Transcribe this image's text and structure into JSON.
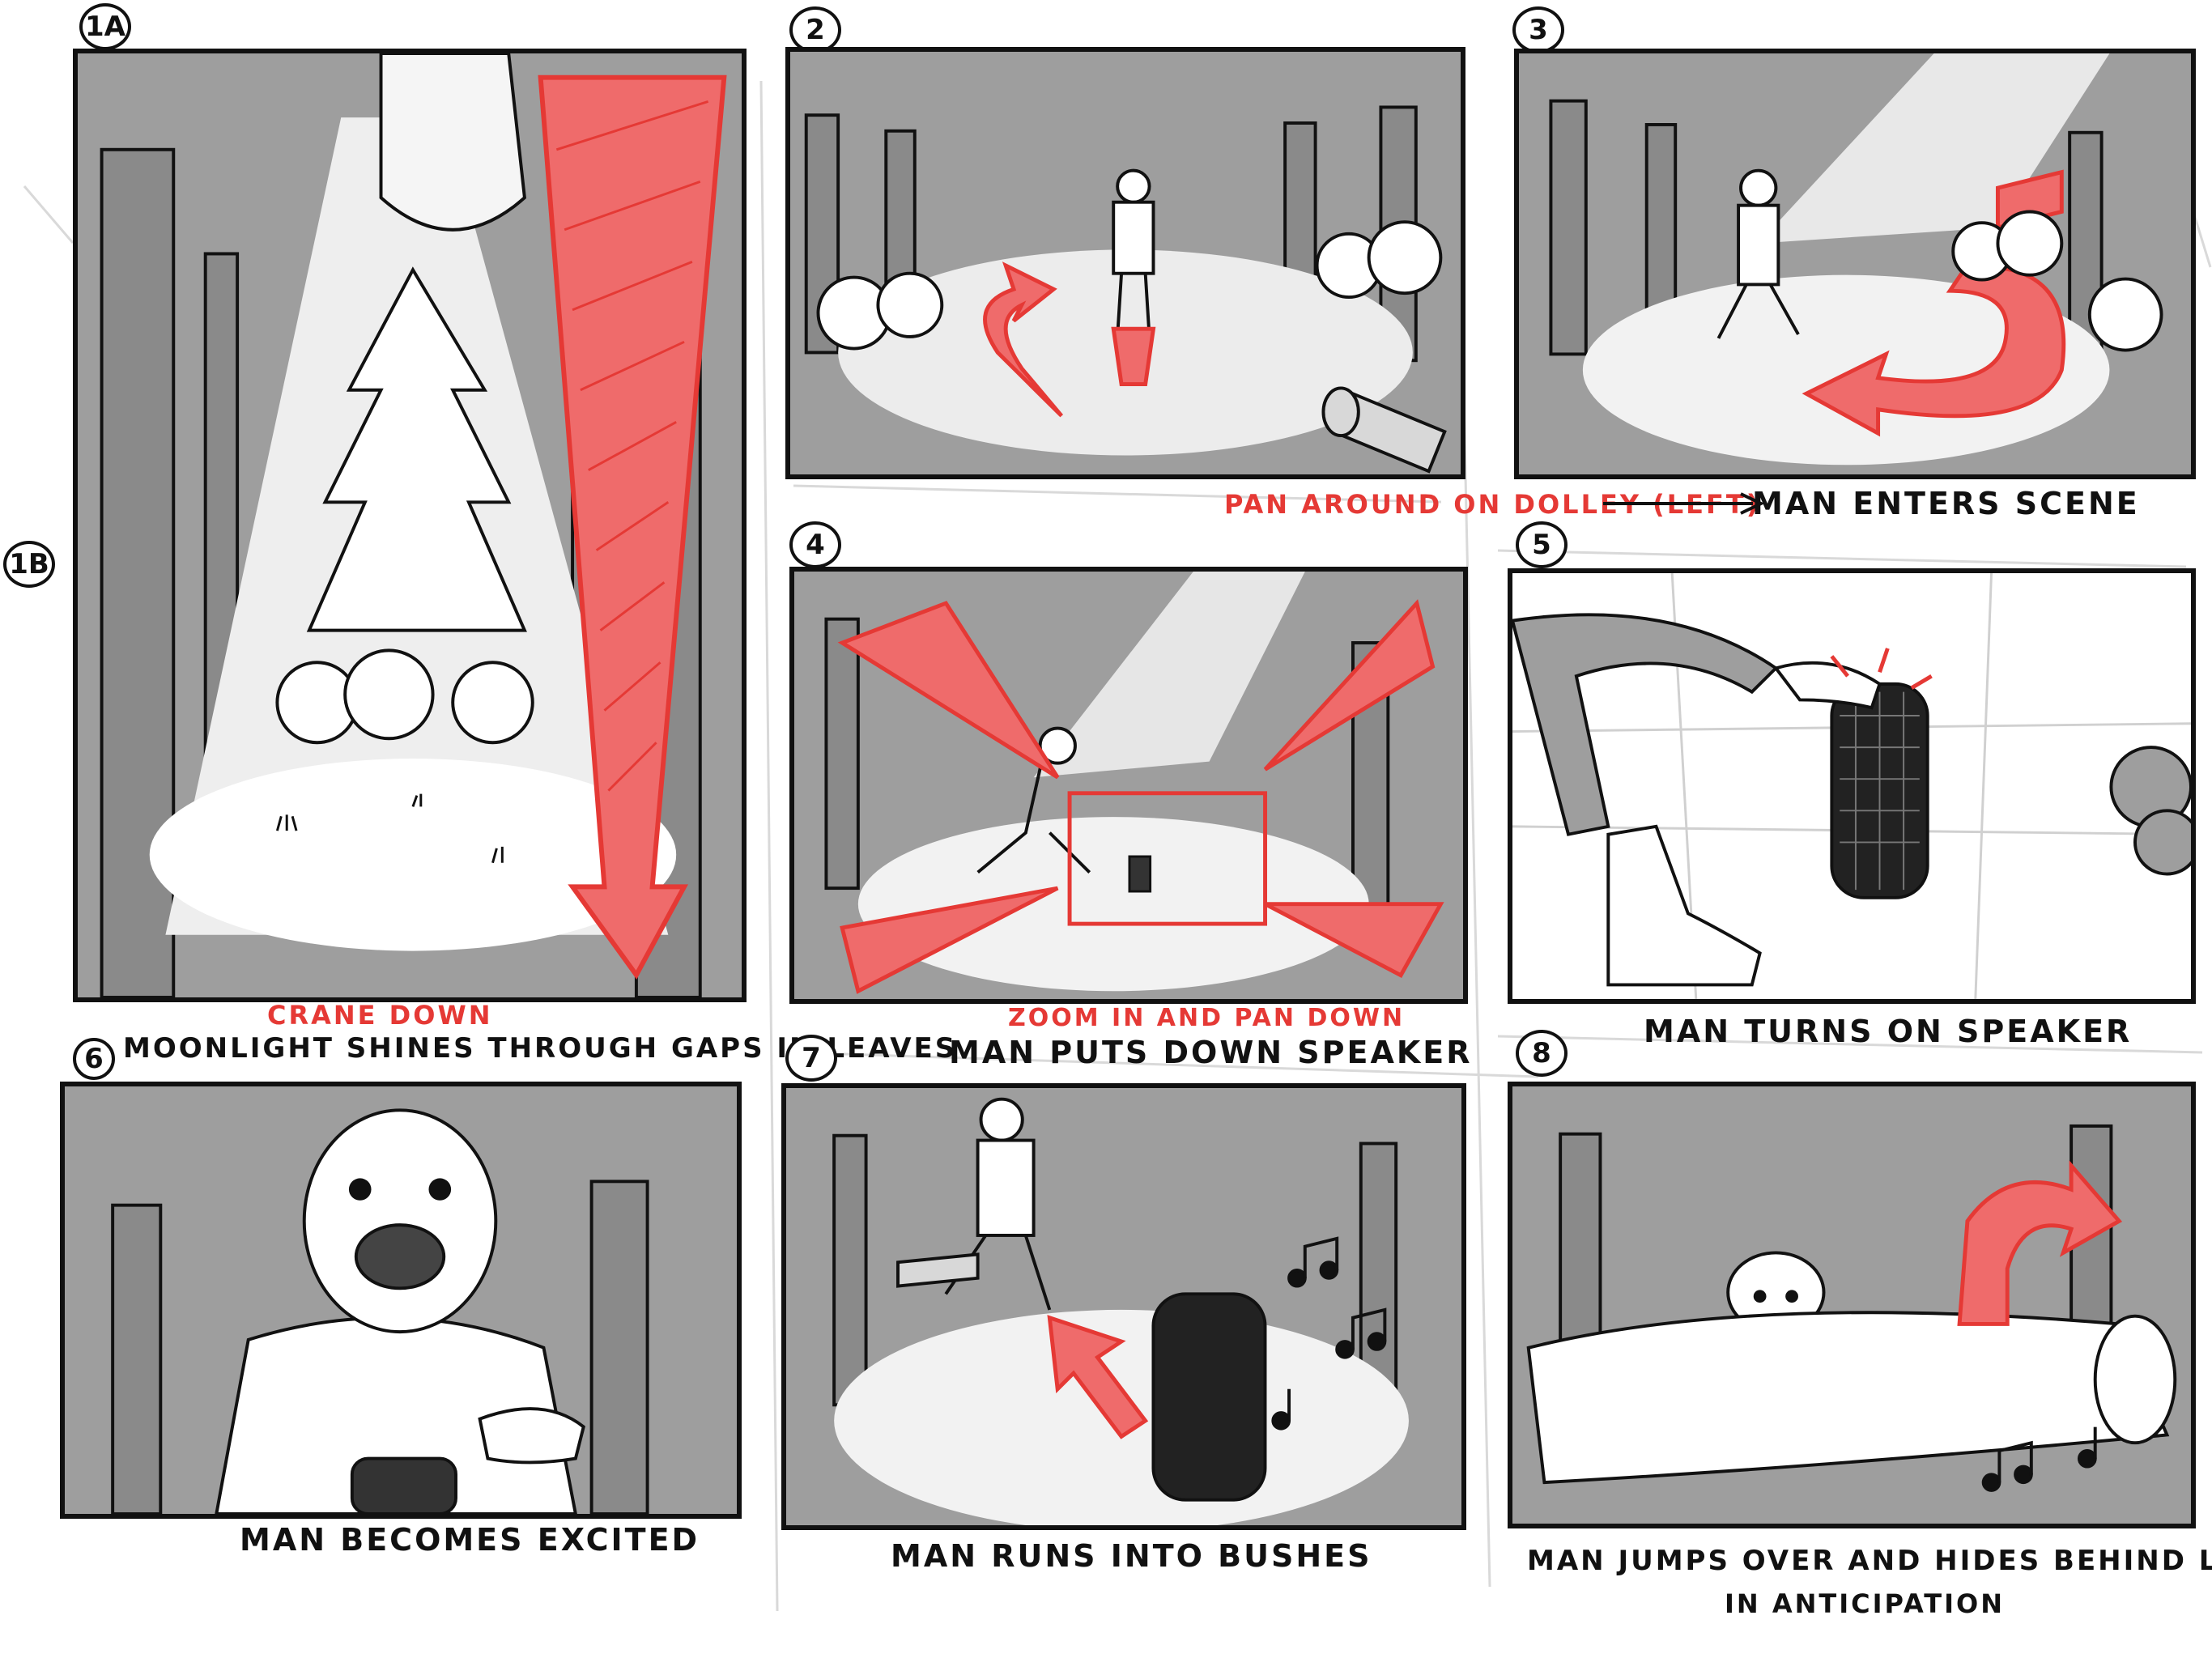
{
  "colors": {
    "ink": "#111111",
    "panel_gray": "#9e9e9e",
    "light": "#ffffff",
    "annotation_red": "#e53935"
  },
  "panels": [
    {
      "number": "1A",
      "caption": "MOONLIGHT SHINES THROUGH GAPS IN LEAVES",
      "note": "CRANE DOWN"
    },
    {
      "number": "2",
      "caption": "",
      "note": ""
    },
    {
      "number": "3",
      "caption": "MAN ENTERS SCENE",
      "note": "PAN AROUND ON DOLLEY (LEFT)"
    },
    {
      "number": "4",
      "caption": "MAN PUTS DOWN SPEAKER",
      "note": "ZOOM IN AND PAN DOWN"
    },
    {
      "number": "5",
      "caption": "MAN TURNS ON SPEAKER",
      "note": ""
    },
    {
      "number": "6",
      "caption": "MAN BECOMES EXCITED",
      "note": ""
    },
    {
      "number": "7",
      "caption": "MAN RUNS INTO BUSHES",
      "note": ""
    },
    {
      "number": "8",
      "caption": "MAN JUMPS OVER AND HIDES BEHIND LOG",
      "caption_line2": "IN ANTICIPATION",
      "note": ""
    }
  ],
  "side_label": "1B",
  "icons": {
    "arrow": "right-arrow-icon",
    "music": "music-note-icon",
    "speaker": "speaker-icon"
  }
}
